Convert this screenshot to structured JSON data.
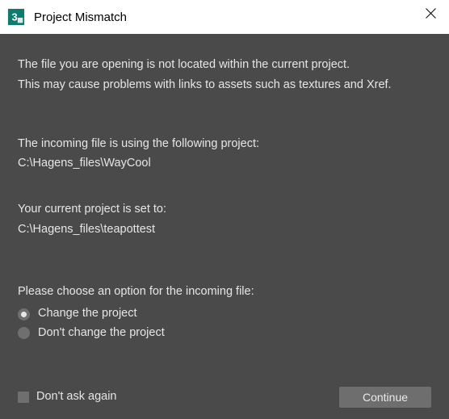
{
  "titlebar": {
    "title": "Project Mismatch"
  },
  "body": {
    "warning_line1": "The file you are opening is not located within the current project.",
    "warning_line2": "This may cause problems with links to assets such as textures and Xref.",
    "incoming_label": "The incoming file is using the following project:",
    "incoming_path": "C:\\Hagens_files\\WayCool",
    "current_label": "Your current project is set to:",
    "current_path": "C:\\Hagens_files\\teapottest",
    "choose_label": "Please choose an option for the incoming file:",
    "radio_change": "Change the project",
    "radio_dont_change": "Don't change the project",
    "dont_ask": "Don't ask again",
    "continue_label": "Continue"
  }
}
